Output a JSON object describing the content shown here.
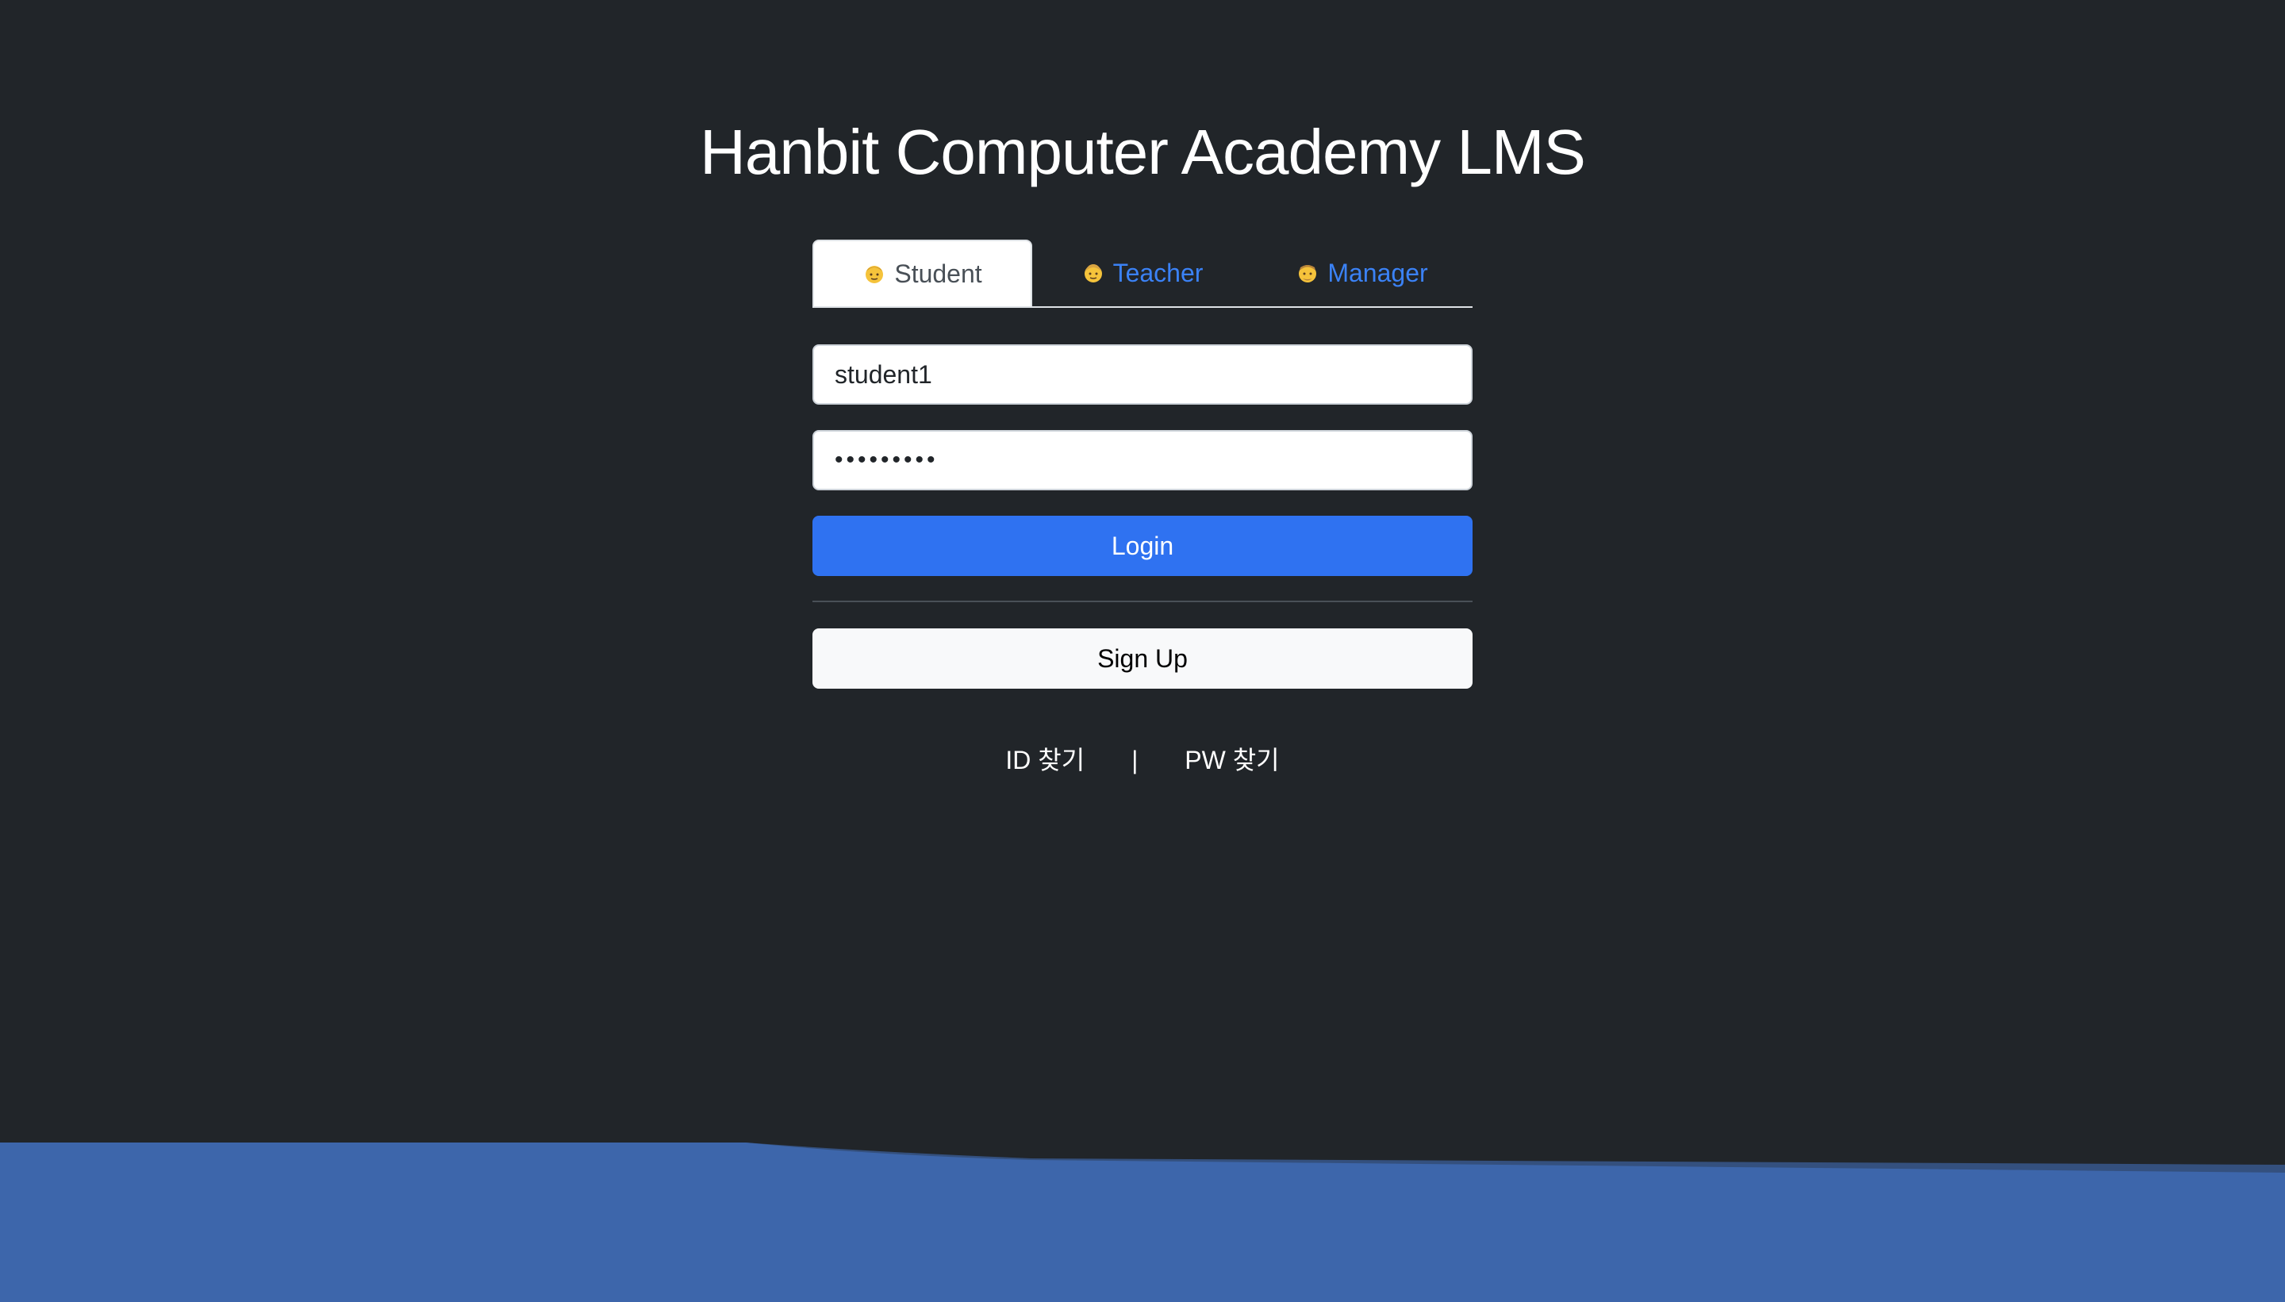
{
  "title": "Hanbit Computer Academy LMS",
  "tabs": [
    {
      "label": "Student",
      "active": true
    },
    {
      "label": "Teacher",
      "active": false
    },
    {
      "label": "Manager",
      "active": false
    }
  ],
  "form": {
    "username_value": "student1",
    "password_value": "•••••••••",
    "login_label": "Login",
    "signup_label": "Sign Up"
  },
  "links": {
    "find_id": "ID 찾기",
    "separator": "|",
    "find_pw": "PW 찾기"
  },
  "colors": {
    "background": "#212529",
    "primary": "#2f72f1",
    "wave": "#3d66ab",
    "tab_link": "#3b82f6"
  }
}
